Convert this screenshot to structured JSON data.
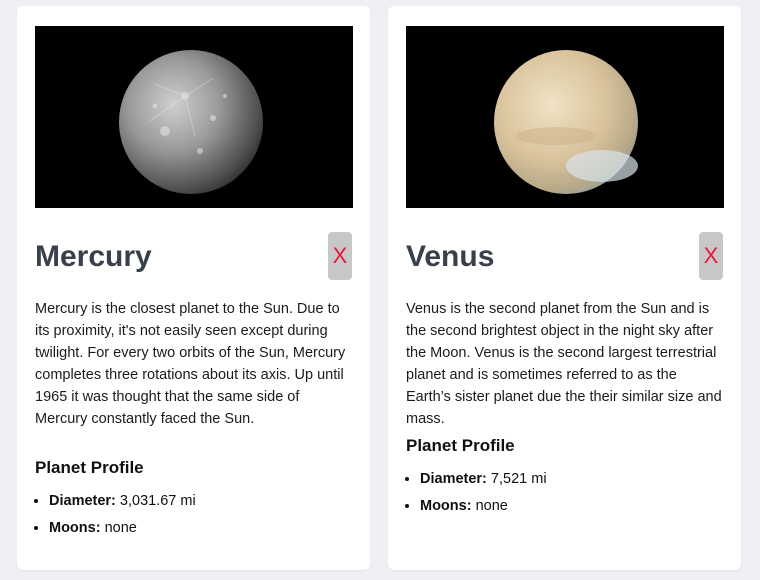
{
  "planets": [
    {
      "name": "Mercury",
      "remove_label": "X",
      "description": "Mercury is the closest planet to the Sun. Due to its proximity, it's not easily seen except during twilight. For every two orbits of the Sun, Mercury completes three rotations about its axis. Up until 1965 it was thought that the same side of Mercury constantly faced the Sun.",
      "profile_heading": "Planet Profile",
      "diameter_label": "Diameter:",
      "diameter_value": "3,031.67 mi",
      "moons_label": "Moons:",
      "moons_value": "none"
    },
    {
      "name": "Venus",
      "remove_label": "X",
      "description": "Venus is the second planet from the Sun and is the second brightest object in the night sky after the Moon. Venus is the second largest terrestrial planet and is sometimes referred to as the Earth’s sister planet due the their similar size and mass.",
      "profile_heading": "Planet Profile",
      "diameter_label": "Diameter:",
      "diameter_value": "7,521 mi",
      "moons_label": "Moons:",
      "moons_value": "none"
    }
  ],
  "colors": {
    "page_background": "#eef0f3",
    "card_background": "#ffffff",
    "title_color": "#37404b",
    "remove_button_bg": "#c7c7c7",
    "remove_button_text": "#e8173f"
  }
}
